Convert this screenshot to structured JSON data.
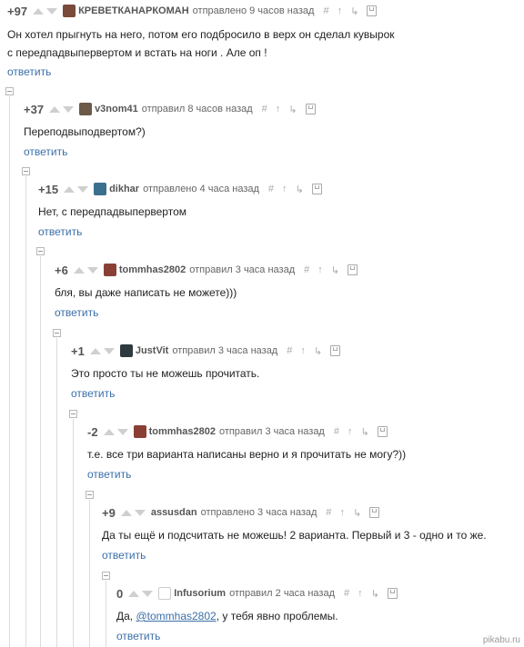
{
  "comments": [
    {
      "rating": "+97",
      "author": "КРЕВЕТКАНАРКОМАН",
      "meta": "отправлено 9 часов назад",
      "text_lines": [
        "Он хотел прыгнуть на него, потом его подбросило в верх он сделал кувырок",
        "с передпадвыпервертом и встать на ноги . Але оп !"
      ],
      "reply": "ответить"
    },
    {
      "rating": "+37",
      "author": "v3nom41",
      "meta": "отправил 8 часов назад",
      "text_lines": [
        "Переподвыподвертом?)"
      ],
      "reply": "ответить"
    },
    {
      "rating": "+15",
      "author": "dikhar",
      "meta": "отправлено 4 часа назад",
      "text_lines": [
        "Нет, с передпадвыпервертом"
      ],
      "reply": "ответить"
    },
    {
      "rating": "+6",
      "author": "tommhas2802",
      "meta": "отправил 3 часа назад",
      "text_lines": [
        "бля, вы даже написать не можете)))"
      ],
      "reply": "ответить"
    },
    {
      "rating": "+1",
      "author": "JustVit",
      "meta": "отправил 3 часа назад",
      "text_lines": [
        "Это просто ты не можешь прочитать."
      ],
      "reply": "ответить"
    },
    {
      "rating": "-2",
      "author": "tommhas2802",
      "meta": "отправил 3 часа назад",
      "text_lines": [
        "т.е. все три варианта написаны верно и я прочитать не могу?))"
      ],
      "reply": "ответить"
    },
    {
      "rating": "+9",
      "author": "assusdan",
      "meta": "отправлено 3 часа назад",
      "text_lines": [
        "Да ты ещё и подсчитать не можешь! 2 варианта. Первый и 3 - одно и то же."
      ],
      "reply": "ответить"
    },
    {
      "rating": "0",
      "author": "Infusorium",
      "meta": "отправил 2 часа назад",
      "text_prefix": "Да, ",
      "mention": "@tommhas2802",
      "text_suffix": ",  у тебя явно проблемы.",
      "reply": "ответить"
    }
  ],
  "icons": {
    "hash": "#",
    "up": "↑",
    "link": "↳"
  },
  "watermark": "pikabu.ru",
  "colors": {
    "link": "#3a6fa8",
    "vote_arrow": "#cfcfcf",
    "thread_line": "#dcdcdc"
  }
}
